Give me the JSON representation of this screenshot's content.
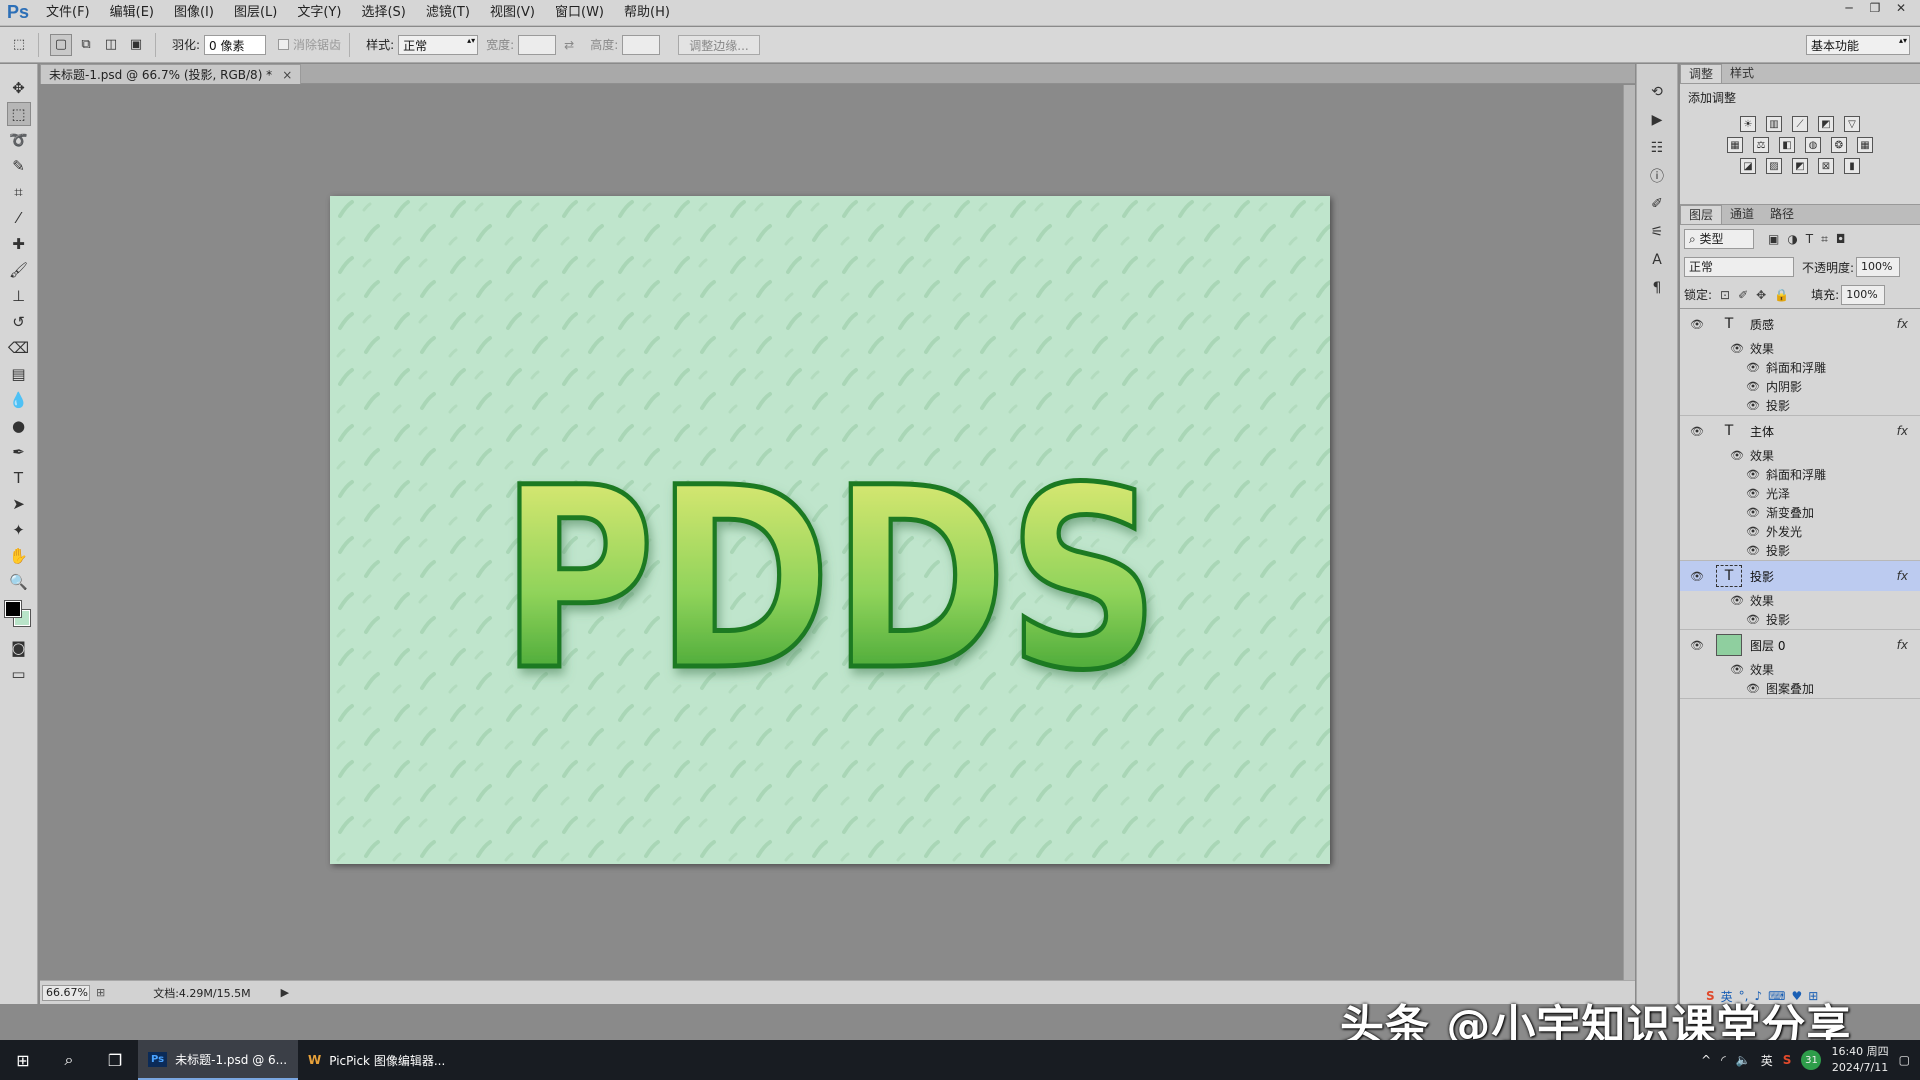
{
  "app": {
    "logo": "Ps"
  },
  "menu": [
    "文件(F)",
    "编辑(E)",
    "图像(I)",
    "图层(L)",
    "文字(Y)",
    "选择(S)",
    "滤镜(T)",
    "视图(V)",
    "窗口(W)",
    "帮助(H)"
  ],
  "window_controls": {
    "minimize": "─",
    "restore": "❐",
    "close": "✕"
  },
  "options": {
    "feather_label": "羽化:",
    "feather_value": "0 像素",
    "antialias_label": "消除锯齿",
    "style_label": "样式:",
    "style_value": "正常",
    "width_label": "宽度:",
    "height_label": "高度:",
    "refine_button": "调整边缘...",
    "workspace": "基本功能"
  },
  "document": {
    "tab_title": "未标题-1.psd @ 66.7% (投影, RGB/8) *",
    "tab_close": "×",
    "canvas_text": "PDDS",
    "zoom": "66.67%",
    "doc_info": "文档:4.29M/15.5M"
  },
  "adjustments": {
    "tabs": [
      "调整",
      "样式"
    ],
    "title": "添加调整"
  },
  "layers_panel": {
    "tabs": [
      "图层",
      "通道",
      "路径"
    ],
    "filter_label": "类型",
    "blend_mode": "正常",
    "opacity_label": "不透明度:",
    "opacity_value": "100%",
    "lock_label": "锁定:",
    "fill_label": "填充:",
    "fill_value": "100%",
    "effects_label": "效果",
    "layers": [
      {
        "name": "质感",
        "type": "text",
        "effects": [
          "斜面和浮雕",
          "内阴影",
          "投影"
        ]
      },
      {
        "name": "主体",
        "type": "text",
        "effects": [
          "斜面和浮雕",
          "光泽",
          "渐变叠加",
          "外发光",
          "投影"
        ]
      },
      {
        "name": "投影",
        "type": "text",
        "effects": [
          "投影"
        ],
        "selected": true
      },
      {
        "name": "图层 0",
        "type": "image",
        "effects": [
          "图案叠加"
        ]
      }
    ]
  },
  "taskbar": {
    "apps": [
      {
        "label": "未标题-1.psd @ 6...",
        "active": true
      },
      {
        "label": "PicPick 图像编辑器...",
        "active": false
      }
    ],
    "tray_lang": "英",
    "tray_badge": "31",
    "time": "16:40 周四",
    "date": "2024/7/11"
  },
  "ime_lang": "英",
  "watermark": "头条 @小宇知识课堂分享",
  "colors": {
    "canvas_bg": "#bfe5cc",
    "text_top": "#f3ef7a",
    "text_bottom": "#1f8f23",
    "selected_layer": "#bccbf0"
  }
}
